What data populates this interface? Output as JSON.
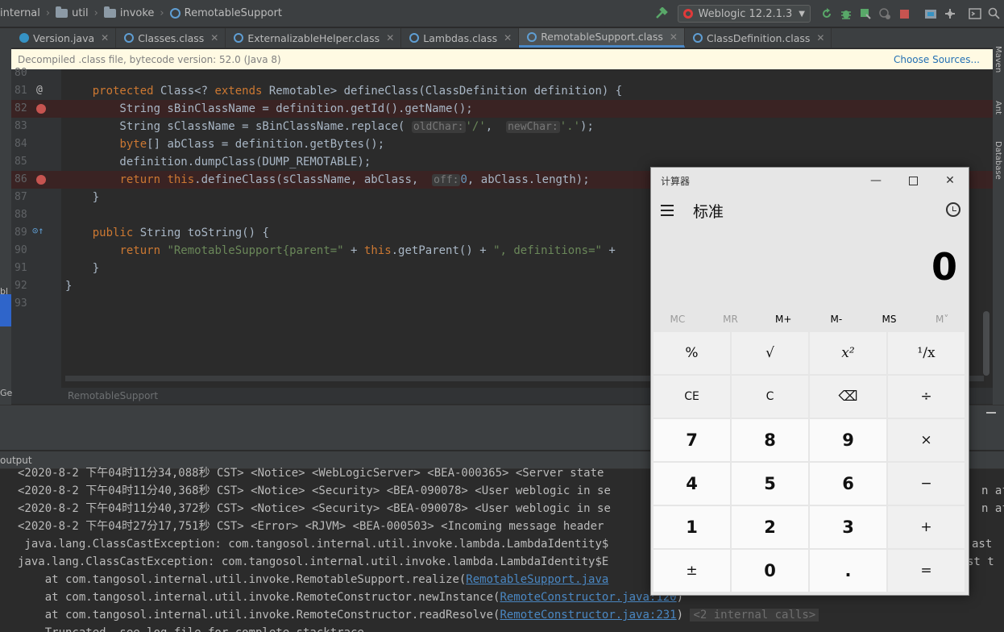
{
  "breadcrumb": {
    "items": [
      "internal",
      "util",
      "invoke",
      "RemotableSupport"
    ]
  },
  "run_config": {
    "label": "Weblogic 12.2.1.3"
  },
  "tabs": [
    {
      "label": "Version.java",
      "kind": "java"
    },
    {
      "label": "Classes.class",
      "kind": "class"
    },
    {
      "label": "ExternalizableHelper.class",
      "kind": "class"
    },
    {
      "label": "Lambdas.class",
      "kind": "class"
    },
    {
      "label": "RemotableSupport.class",
      "kind": "class",
      "active": true
    },
    {
      "label": "ClassDefinition.class",
      "kind": "class"
    }
  ],
  "right_tools": [
    "Maven",
    "Ant",
    "Database"
  ],
  "banner": {
    "message": "Decompiled .class file, bytecode version: 52.0 (Java 8)",
    "link": "Choose Sources..."
  },
  "editor": {
    "line_numbers": [
      "80",
      "81",
      "82",
      "83",
      "84",
      "85",
      "86",
      "87",
      "88",
      "89",
      "90",
      "91",
      "92",
      "93"
    ],
    "hints": {
      "oldChar": "oldChar:",
      "newChar": "newChar:",
      "off": "off:"
    }
  },
  "status_crumb": "RemotableSupport",
  "left_cut": {
    "a": "bl",
    "b": "Ge"
  },
  "output_label": "output",
  "console": {
    "lines": [
      "<2020-8-2 下午04时11分34,088秒 CST> <Notice> <WebLogicServer> <BEA-000365> <Server state",
      "<2020-8-2 下午04时11分40,368秒 CST> <Notice> <Security> <BEA-090078> <User weblogic in se",
      "<2020-8-2 下午04时11分40,372秒 CST> <Notice> <Security> <BEA-090078> <User weblogic in se",
      "<2020-8-2 下午04时27分17,751秒 CST> <Error> <RJVM> <BEA-000503> <Incoming message header",
      " java.lang.ClassCastException: com.tangosol.internal.util.invoke.lambda.LambdaIdentity$",
      "java.lang.ClassCastException: com.tangosol.internal.util.invoke.lambda.LambdaIdentity$E",
      "    at com.tangosol.internal.util.invoke.RemotableSupport.realize(",
      "    at com.tangosol.internal.util.invoke.RemoteConstructor.newInstance(",
      "    at com.tangosol.internal.util.invoke.RemoteConstructor.readResolve(",
      "    Truncated. see log file for complete stacktrace"
    ],
    "links": [
      "RemotableSupport.java",
      "RemoteConstructor.java:120",
      "RemoteConstructor.java:231"
    ],
    "fold": "<2 internal calls>",
    "right_tails": [
      "n af",
      "n af",
      "ast",
      "st t"
    ]
  },
  "calculator": {
    "title": "计算器",
    "mode": "标准",
    "display": "0",
    "memory": [
      "MC",
      "MR",
      "M+",
      "M-",
      "MS",
      "M˅"
    ],
    "keys": [
      "%",
      "√",
      "x²",
      "¹/x",
      "CE",
      "C",
      "⌫",
      "÷",
      "7",
      "8",
      "9",
      "×",
      "4",
      "5",
      "6",
      "−",
      "1",
      "2",
      "3",
      "+",
      "±",
      "0",
      ".",
      "="
    ]
  }
}
